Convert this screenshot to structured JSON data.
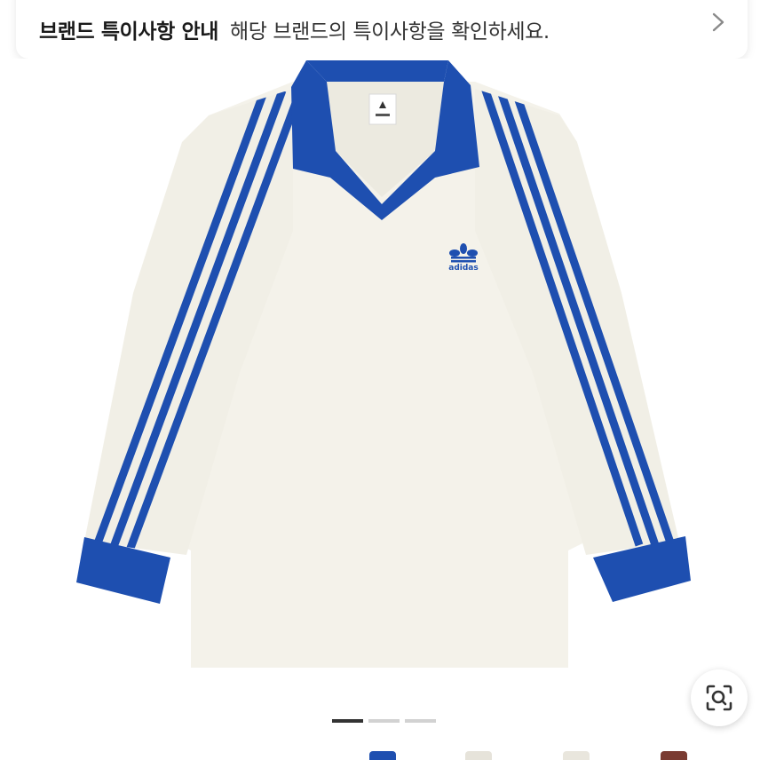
{
  "notice": {
    "title": "브랜드 특이사항 안내",
    "description": "해당 브랜드의 특이사항을 확인하세요."
  },
  "product": {
    "brand_logo_text": "adidas",
    "colors": {
      "body": "#F4F2EA",
      "accent": "#1E4FB0"
    }
  },
  "pager": {
    "total": 3,
    "active_index": 0
  },
  "icons": {
    "chevron": "chevron-right-icon",
    "lens": "image-search-icon"
  }
}
